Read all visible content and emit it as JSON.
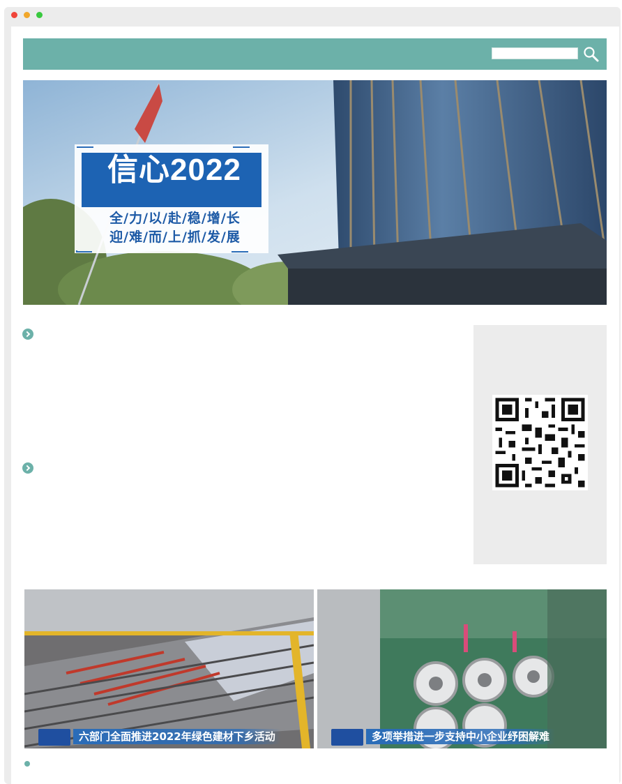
{
  "window": {
    "controls": [
      "close",
      "minimize",
      "zoom"
    ]
  },
  "colors": {
    "accent": "#6cb1a9",
    "panel": "#ececec",
    "banner_blue": "#1d5aa6"
  },
  "search": {
    "value": "",
    "placeholder": "",
    "icon": "magnifier-icon"
  },
  "banner": {
    "title": "信心2022",
    "line1": "全/力/以/赴/稳/增/长",
    "line2": "迎/难/而/上/抓/发/展"
  },
  "news": {
    "bullet_icon": "chevron-right-icon"
  },
  "qr": {
    "icon": "qr-code"
  },
  "videos": [
    {
      "caption": "六部门全面推进2022年绿色建材下乡活动"
    },
    {
      "caption": "多项举措进一步支持中小企业纾困解难"
    }
  ]
}
